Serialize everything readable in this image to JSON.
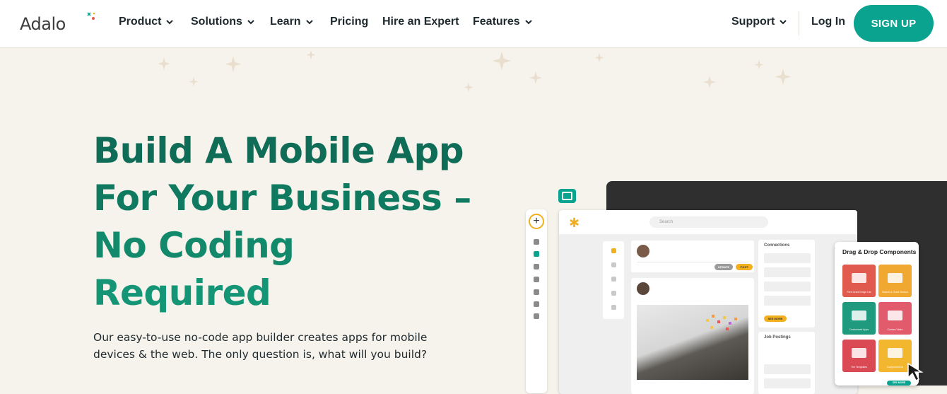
{
  "brand": {
    "name": "Adalo",
    "accent": "#0aa38f",
    "heading_color": "#0f6d57"
  },
  "nav": {
    "items": [
      {
        "label": "Product",
        "dropdown": true
      },
      {
        "label": "Solutions",
        "dropdown": true
      },
      {
        "label": "Learn",
        "dropdown": true
      },
      {
        "label": "Pricing",
        "dropdown": false
      },
      {
        "label": "Hire an Expert",
        "dropdown": false
      },
      {
        "label": "Features",
        "dropdown": true
      }
    ],
    "support_label": "Support",
    "login_label": "Log In",
    "signup_label": "SIGN UP"
  },
  "hero": {
    "title_lines": [
      "Build A Mobile App",
      "For Your Business –",
      "No Coding",
      "Required"
    ],
    "subtitle": "Our easy-to-use no-code app builder creates apps for mobile devices & the web. The only question is, what will you build?"
  },
  "mockup": {
    "search_placeholder": "Search",
    "connections_label": "Connections",
    "job_postings_label": "Job Postings",
    "update_label": "UPDATE",
    "post_label": "POST",
    "see_more_label": "SEE MORE",
    "panel_title": "Drag & Drop Components",
    "components": [
      {
        "label": "Free Grant Image List",
        "color": "#e05a4e"
      },
      {
        "label": "Search & Grant Section",
        "color": "#f0a830"
      },
      {
        "label": "Customized Apps",
        "color": "#1f9a7e"
      },
      {
        "label": "Custom Video",
        "color": "#e25b6d"
      },
      {
        "label": "The Templates",
        "color": "#d94a55"
      },
      {
        "label": "Component Kit",
        "color": "#f2b72e"
      }
    ],
    "see_all_label": "SEE MORE"
  }
}
